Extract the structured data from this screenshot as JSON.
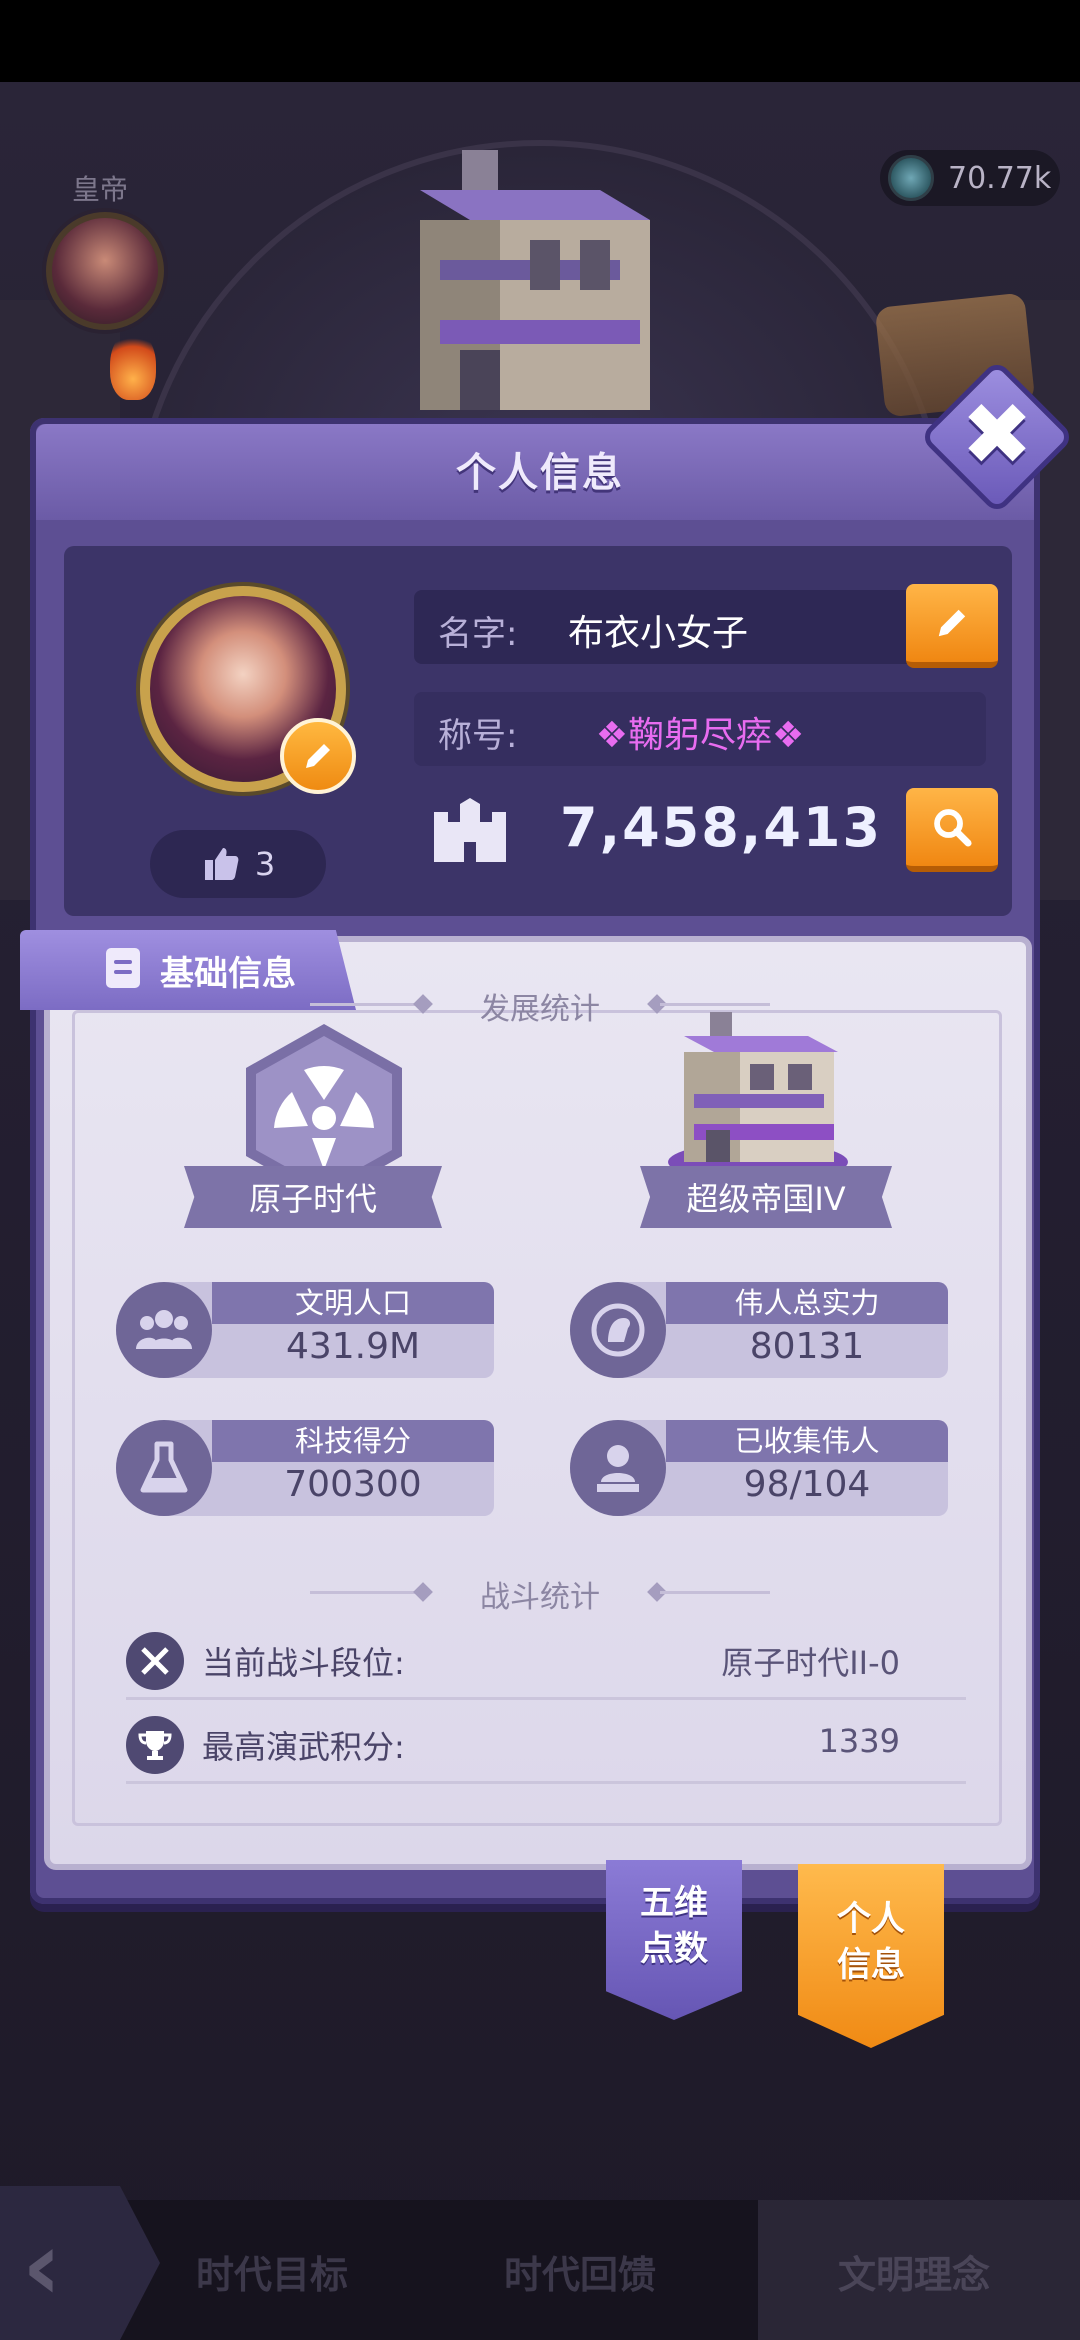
{
  "header": {
    "emperor_label": "皇帝",
    "currency_value": "70.77k"
  },
  "panel": {
    "title": "个人信息",
    "close_glyph": "✖"
  },
  "profile": {
    "name_label": "名字:",
    "name_value": "布衣小女子",
    "title_label": "称号:",
    "title_value": "❖鞠躬尽瘁❖",
    "power_value": "7,458,413",
    "likes": "3"
  },
  "basic_info": {
    "tab_label": "基础信息",
    "dev_section": "发展统计",
    "era_name": "原子时代",
    "empire_name": "超级帝国IV",
    "stats": [
      {
        "label": "文明人口",
        "value": "431.9M",
        "icon": "people-icon"
      },
      {
        "label": "伟人总实力",
        "value": "80131",
        "icon": "portrait-icon"
      },
      {
        "label": "科技得分",
        "value": "700300",
        "icon": "flask-icon"
      },
      {
        "label": "已收集伟人",
        "value": "98/104",
        "icon": "bust-icon"
      }
    ],
    "battle_section": "战斗统计",
    "battle": [
      {
        "label": "当前战斗段位:",
        "value": "原子时代II-0",
        "icon": "crossed-swords-icon"
      },
      {
        "label": "最高演武积分:",
        "value": "1339",
        "icon": "trophy-icon"
      }
    ]
  },
  "side_tabs": {
    "five_dim": "五维\n点数",
    "personal_info": "个人\n信息"
  },
  "bottom_nav": {
    "items": [
      "时代目标",
      "时代回馈",
      "文明理念"
    ]
  },
  "colors": {
    "panel": "#5d4f93",
    "accent_orange": "#f08712",
    "title_pink": "#e86cf0"
  }
}
